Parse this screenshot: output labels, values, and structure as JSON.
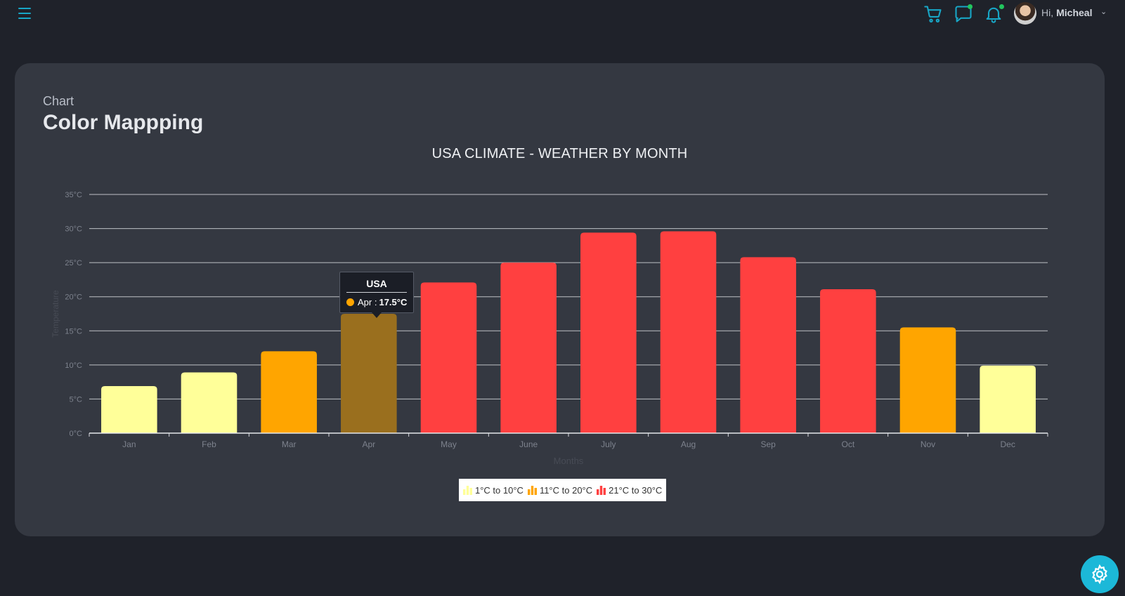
{
  "header": {
    "greeting": "Hi,",
    "user_name": "Micheal",
    "icons": [
      "menu-icon",
      "cart-icon",
      "chat-icon",
      "bell-icon",
      "avatar",
      "chevron-down-icon"
    ]
  },
  "card": {
    "subtitle": "Chart",
    "title": "Color Mappping"
  },
  "chart_data": {
    "type": "bar",
    "title": "USA CLIMATE - WEATHER BY MONTH",
    "xlabel": "Months",
    "ylabel": "Temperature",
    "categories": [
      "Jan",
      "Feb",
      "Mar",
      "Apr",
      "May",
      "June",
      "July",
      "Aug",
      "Sep",
      "Oct",
      "Nov",
      "Dec"
    ],
    "series": [
      {
        "name": "USA",
        "values": [
          6.9,
          8.9,
          12.0,
          17.5,
          22.1,
          25.0,
          29.4,
          29.6,
          25.8,
          21.1,
          15.5,
          9.9
        ]
      }
    ],
    "unit": "°C",
    "ylim": [
      0,
      35
    ],
    "yticks": [
      0,
      5,
      10,
      15,
      20,
      25,
      30,
      35
    ],
    "ytick_labels": [
      "0°C",
      "5°C",
      "10°C",
      "15°C",
      "20°C",
      "25°C",
      "30°C",
      "35°C"
    ],
    "grid": true,
    "color_mapping": [
      {
        "label": "1°C to 10°C",
        "color": "#ffff99"
      },
      {
        "label": "11°C to 20°C",
        "color": "#ffa500"
      },
      {
        "label": "21°C to 30°C",
        "color": "#ff4040"
      }
    ],
    "legend_position": "bottom-center",
    "tooltip": {
      "title": "USA",
      "label": "Apr",
      "value_text": "17.5°C",
      "color": "#ffa500"
    },
    "highlight_color": "#9a6f1e"
  },
  "colors": {
    "background": "#1f222a",
    "card": "#343841",
    "accent": "#1cb8d8",
    "notification_dot": "#22c55e"
  },
  "settings_button": {
    "icon": "gear-icon"
  }
}
